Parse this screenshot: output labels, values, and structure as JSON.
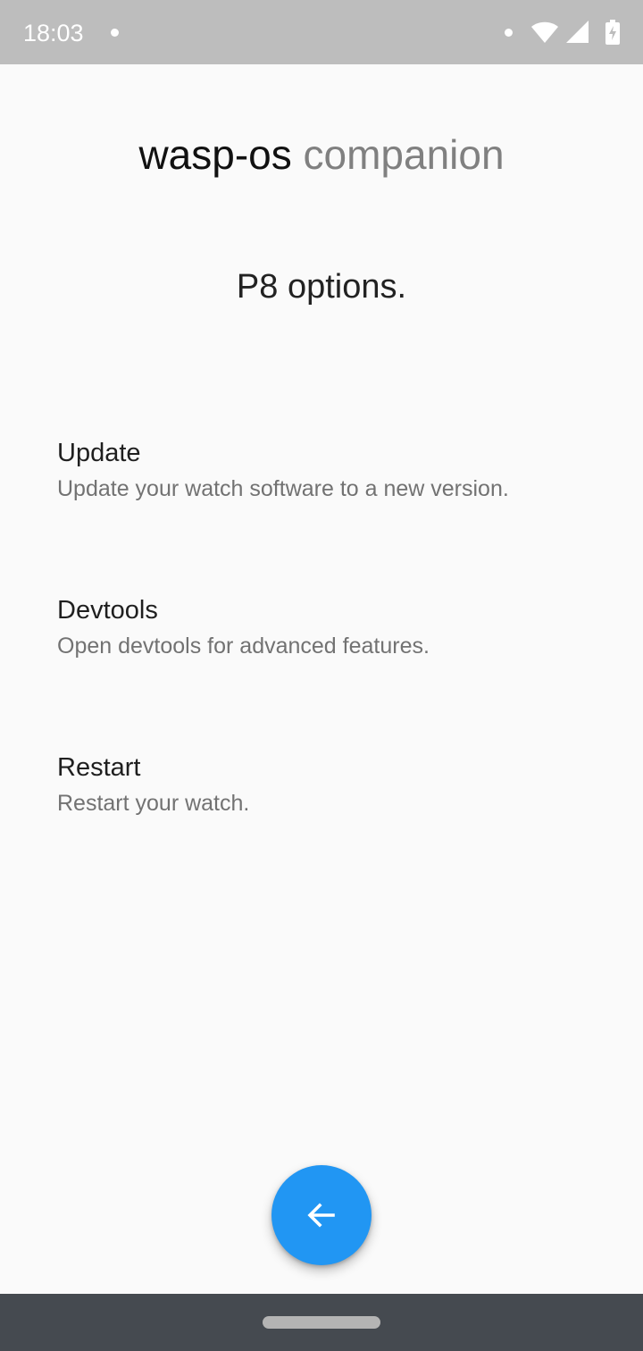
{
  "status_bar": {
    "time": "18:03",
    "icons": [
      "notification-dot-icon",
      "wifi-icon",
      "cellular-signal-icon",
      "battery-charging-icon"
    ]
  },
  "header": {
    "title_primary": "wasp-os",
    "title_secondary": "companion"
  },
  "page": {
    "heading": "P8 options."
  },
  "options": [
    {
      "title": "Update",
      "subtitle": "Update your watch software to a new version."
    },
    {
      "title": "Devtools",
      "subtitle": "Open devtools for advanced features."
    },
    {
      "title": "Restart",
      "subtitle": "Restart your watch."
    }
  ],
  "fab": {
    "icon": "arrow-back-icon",
    "color": "#2196f3"
  },
  "colors": {
    "status_bar": "#bdbdbd",
    "background": "#fafafa",
    "nav_bar": "#454a50",
    "accent": "#2196f3"
  }
}
